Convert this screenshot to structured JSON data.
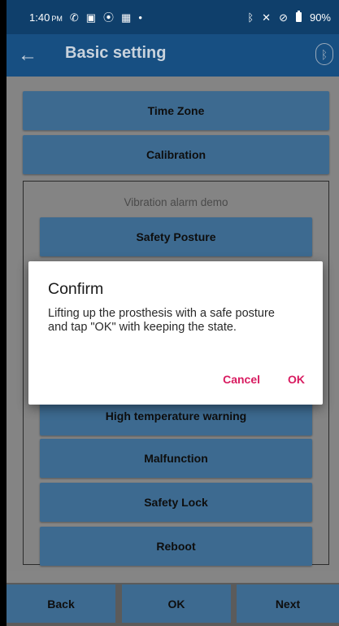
{
  "status_bar": {
    "time": "1:40",
    "ampm": "PM",
    "icons_left": [
      "phone-icon",
      "image-icon",
      "sync-icon",
      "calendar-icon",
      "dot-icon"
    ],
    "icons_right": [
      "bluetooth-icon",
      "mute-icon",
      "no-sim-icon",
      "battery-icon"
    ],
    "battery": "90%"
  },
  "app_bar": {
    "title": "Basic setting",
    "bluetooth_glyph": "ᛒ"
  },
  "buttons": {
    "time_zone": "Time Zone",
    "calibration": "Calibration"
  },
  "demo": {
    "title": "Vibration alarm demo",
    "items": [
      "Safety Posture",
      "High temperature warning",
      "Malfunction",
      "Safety Lock",
      "Reboot"
    ]
  },
  "bottom_bar": {
    "back": "Back",
    "ok": "OK",
    "next": "Next"
  },
  "dialog": {
    "title": "Confirm",
    "message": "Lifting up the prosthesis with a safe posture and tap \"OK\" with keeping the state.",
    "cancel": "Cancel",
    "ok": "OK"
  },
  "colors": {
    "status_bar": "#0f3f6b",
    "app_bar": "#174f82",
    "button": "#3d6a90",
    "accent": "#d81b60"
  }
}
